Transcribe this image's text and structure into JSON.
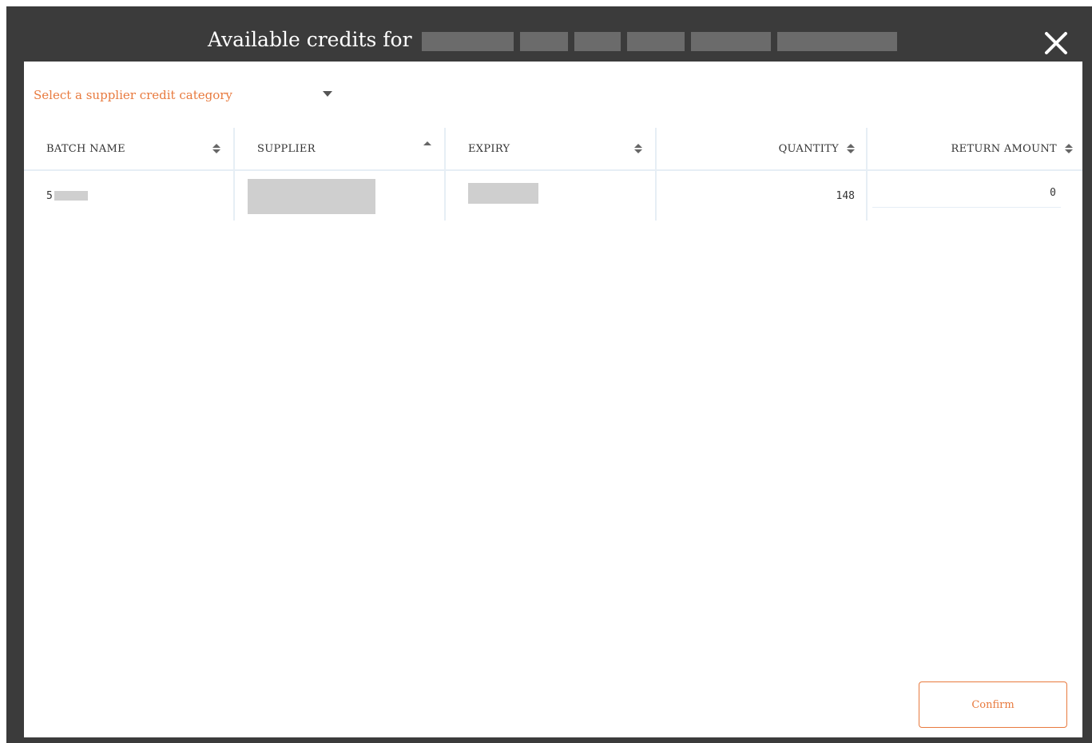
{
  "dialog": {
    "title": "Available credits for"
  },
  "category_select": {
    "placeholder": "Select a supplier credit category"
  },
  "table": {
    "columns": [
      {
        "label": "BATCH NAME",
        "sort": "none"
      },
      {
        "label": "SUPPLIER",
        "sort": "ascending"
      },
      {
        "label": "EXPIRY",
        "sort": "none"
      },
      {
        "label": "QUANTITY",
        "sort": "none"
      },
      {
        "label": "RETURN AMOUNT",
        "sort": "none"
      }
    ],
    "rows": [
      {
        "batch_name": "5",
        "quantity": "148",
        "return_amount": "0"
      }
    ]
  },
  "actions": {
    "confirm_label": "Confirm"
  },
  "colors": {
    "accent": "#e87a3e",
    "frame": "#3b3b3b",
    "divider": "#e6eef5"
  },
  "icons": {
    "close": "close-icon",
    "dropdown": "caret-down-icon",
    "sort": "sort-icon",
    "sort_asc": "sort-ascending-icon"
  }
}
